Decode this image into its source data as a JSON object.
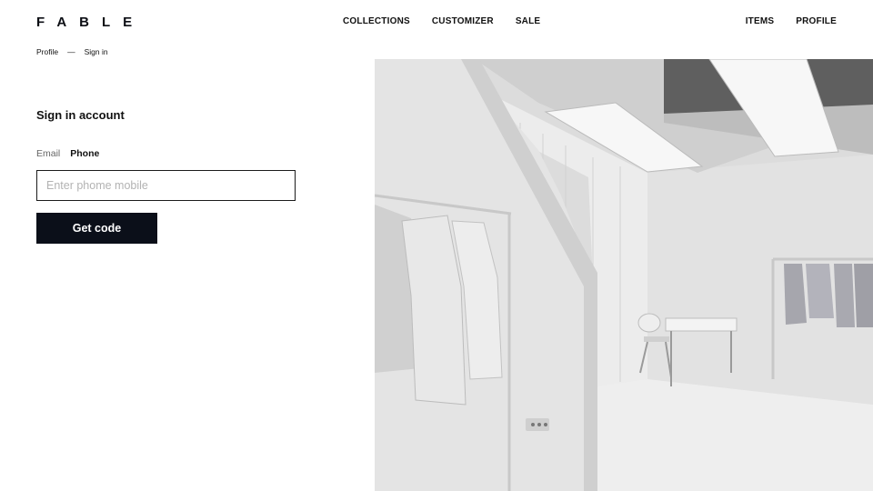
{
  "header": {
    "logo": "FABLE",
    "nav_center": [
      "COLLECTIONS",
      "CUSTOMIZER",
      "SALE"
    ],
    "nav_right": [
      "ITEMS",
      "PROFILE"
    ]
  },
  "breadcrumb": {
    "items": [
      "Profile",
      "Sign in"
    ],
    "separator": "—"
  },
  "signin": {
    "title": "Sign in account",
    "tabs": [
      {
        "label": "Email",
        "active": false
      },
      {
        "label": "Phone",
        "active": true
      }
    ],
    "phone_input": {
      "value": "",
      "placeholder": "Enter phome mobile"
    },
    "submit_label": "Get code"
  },
  "hero_image": {
    "subject": "store-interior-photo"
  },
  "colors": {
    "text": "#111111",
    "button_bg": "#0b0f19",
    "button_text": "#ffffff",
    "placeholder": "#b3b3b3",
    "inactive_tab": "#666666"
  }
}
